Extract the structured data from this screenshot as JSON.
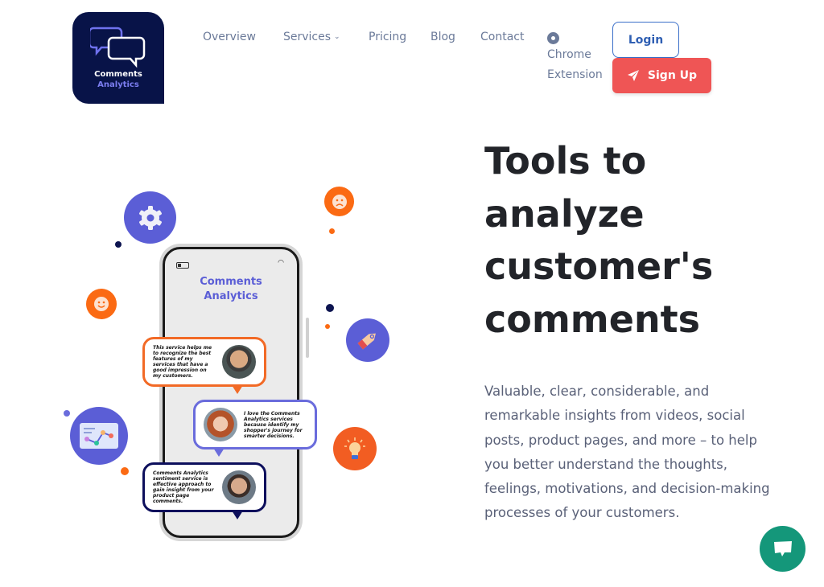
{
  "brand": {
    "line1": "Comments",
    "line2": "Analytics",
    "colors": {
      "logo_bg": "#081348",
      "accent": "#7b7df0"
    }
  },
  "nav": {
    "items": [
      {
        "label": "Overview"
      },
      {
        "label": "Services",
        "icon": "chevron-down-icon",
        "chevron": "⌄"
      },
      {
        "label": "Pricing"
      },
      {
        "label": "Blog"
      },
      {
        "label": "Contact"
      }
    ],
    "extension": {
      "icon": "chrome-icon",
      "line1": "Chrome",
      "line2": "Extension"
    },
    "login_label": "Login",
    "signup_label": "Sign Up",
    "signup_icon": "paper-plane-icon"
  },
  "hero": {
    "title": "Tools to analyze customer's comments",
    "description": "Valuable, clear, considerable, and remarkable insights from videos, social posts, product pages, and more – to help you better understand the thoughts, feelings, motivations, and decision-making processes of your customers."
  },
  "illustration": {
    "phone_title_line1": "Comments",
    "phone_title_line2": "Analytics",
    "testimonials": [
      {
        "text": "This service helps me to recognize the best features of my services that have a good impression on my customers."
      },
      {
        "text": "I love the Comments Analytics services because identify my shopper's journey for smarter decisions."
      },
      {
        "text": "Comments Analytics sentiment service is effective approach to gain insight from your product page comments."
      }
    ],
    "icons": [
      "gear-icon",
      "sad-face-icon",
      "smiley-face-icon",
      "price-tag-icon",
      "chart-card-icon",
      "lightbulb-icon"
    ],
    "colors": {
      "purple": "#5b5ed6",
      "orange": "#fb6a13",
      "navy": "#0d1450"
    }
  },
  "chat_widget": {
    "icon": "chat-bubble-icon",
    "color": "#14977a"
  }
}
